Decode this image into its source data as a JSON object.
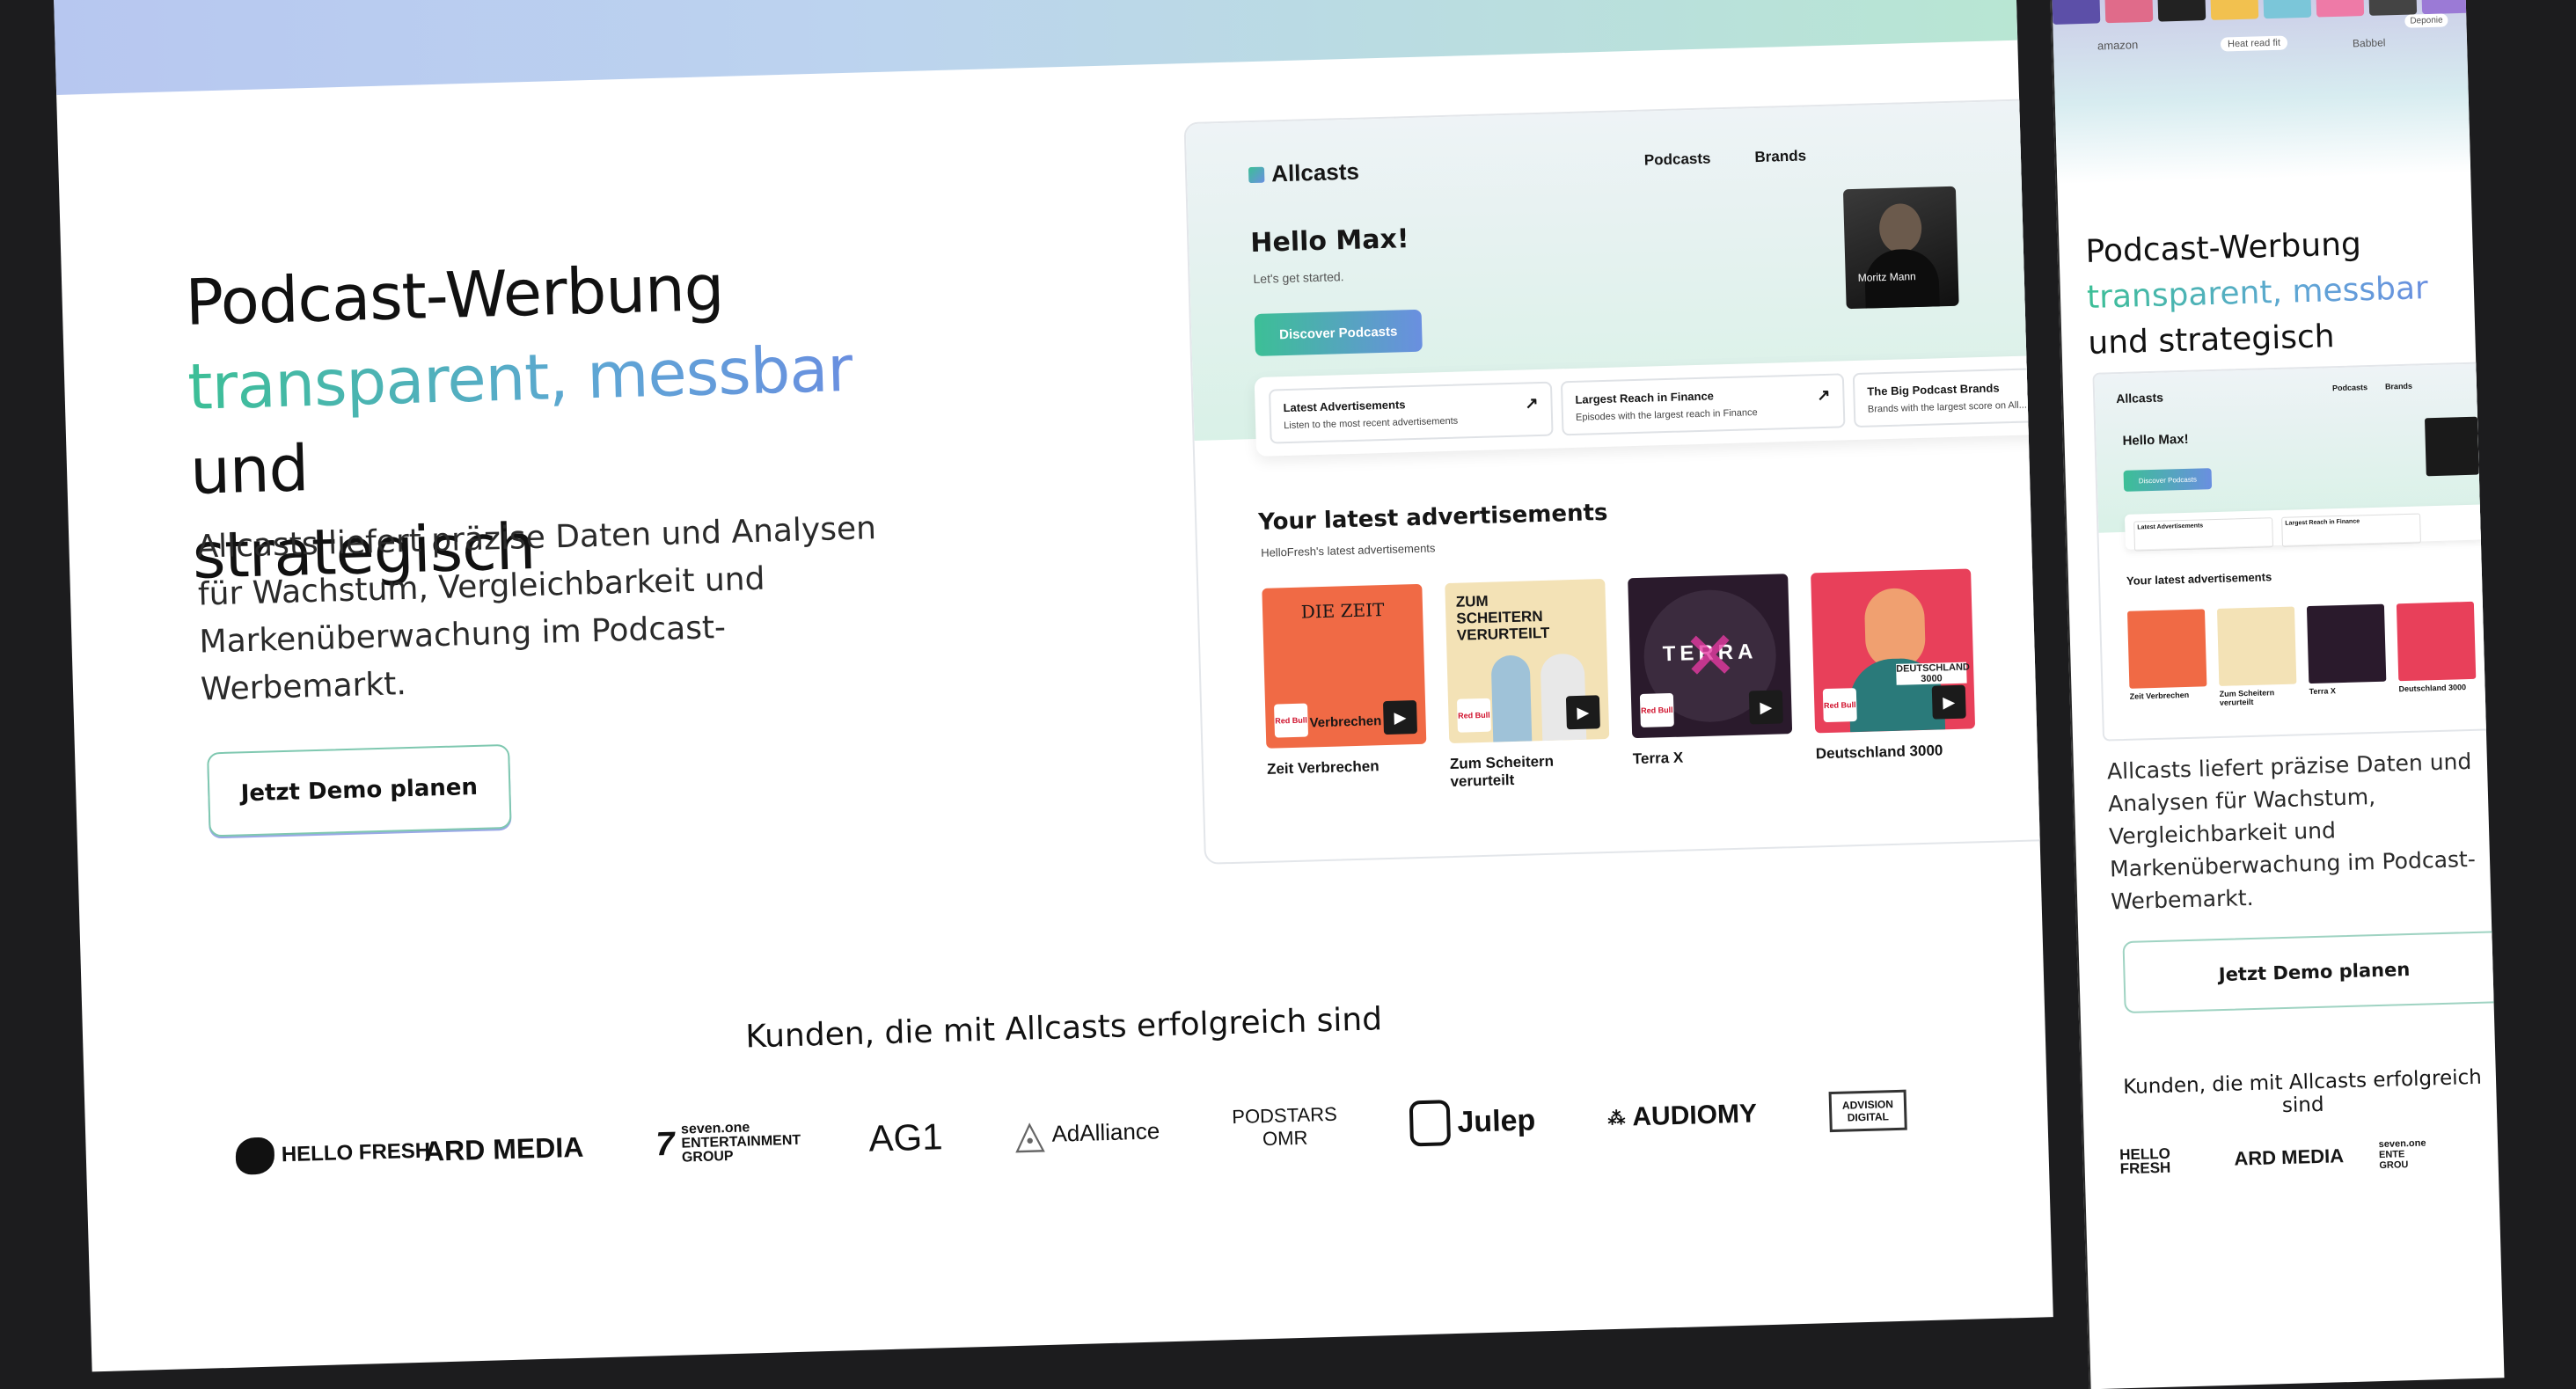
{
  "hero": {
    "title_line1": "Podcast-Werbung",
    "title_highlight": "transparent, messbar",
    "title_and": " und",
    "title_line3": "strategisch",
    "subtitle": "Allcasts liefert präzise Daten und Analysen für Wachstum, Vergleichbarkeit und Markenüberwachung im Podcast-Werbemarkt.",
    "cta_label": "Jetzt Demo planen"
  },
  "app": {
    "brand": "Allcasts",
    "nav": [
      "Podcasts",
      "Brands"
    ],
    "greeting": "Hello Max!",
    "greeting_sub": "Let's get started.",
    "discover_label": "Discover Podcasts",
    "profile_name": "Moritz Mann",
    "quick_cards": [
      {
        "title": "Latest Advertisements",
        "subtitle": "Listen to the most recent advertisements"
      },
      {
        "title": "Largest Reach in Finance",
        "subtitle": "Episodes with the largest reach in Finance"
      },
      {
        "title": "The Big Podcast Brands",
        "subtitle": "Brands with the largest score on All..."
      }
    ],
    "latest_title": "Your latest advertisements",
    "latest_sub": "HelloFresh's latest advertisements",
    "podcasts": [
      {
        "title": "Zeit Verbrechen",
        "cover_text": "Verbrechen",
        "color": "#f06a45"
      },
      {
        "title": "Zum Scheitern verurteilt",
        "cover_text": "ZUM SCHEITERN VERURTEILT",
        "color": "#f3e2b6"
      },
      {
        "title": "Terra X",
        "cover_text": "TERRA",
        "color": "#2a1a2c"
      },
      {
        "title": "Deutschland 3000",
        "cover_text": "DEUTSCHLAND 3000",
        "color": "#e8405a"
      }
    ],
    "sponsor_badge": "Red Bull"
  },
  "customers": {
    "title": "Kunden, die mit Allcasts erfolgreich sind",
    "logos": [
      "HELLO FRESH",
      "ARD MEDIA",
      "seven.one ENTERTAINMENT GROUP",
      "AG1",
      "AdAlliance",
      "PODSTARS OMR",
      "Julep",
      "AUDIOMY",
      "ADVISION DIGITAL"
    ]
  },
  "mobile": {
    "top_labels": [
      "amazon",
      "Heat read fit",
      "Babbel",
      "Deponie"
    ],
    "mobile_logos": [
      "HELLO FRESH",
      "ARD MEDIA",
      "seven.one ENTE GROU"
    ]
  },
  "colors": {
    "accent_green": "#3cbf96",
    "accent_blue": "#6a8fe0",
    "background": "#1c1c1e"
  }
}
